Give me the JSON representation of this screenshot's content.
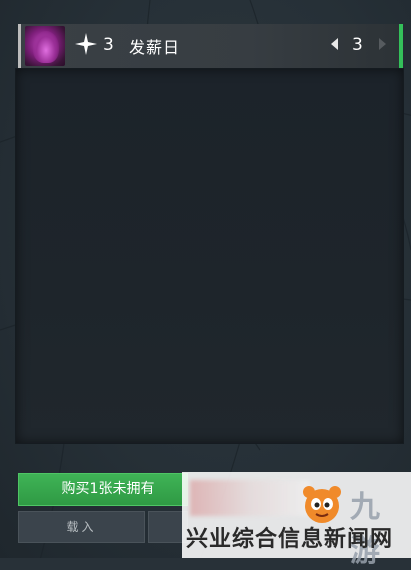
{
  "card": {
    "cost": "3",
    "name": "发薪日",
    "count": "3",
    "star_icon": "sparkle-icon",
    "accent_color": "#34c05a"
  },
  "buttons": {
    "buy_label": "购买1张未拥有",
    "load_label": "载入"
  },
  "watermark": {
    "logo_text": "九游",
    "caption": "兴业综合信息新闻网"
  }
}
